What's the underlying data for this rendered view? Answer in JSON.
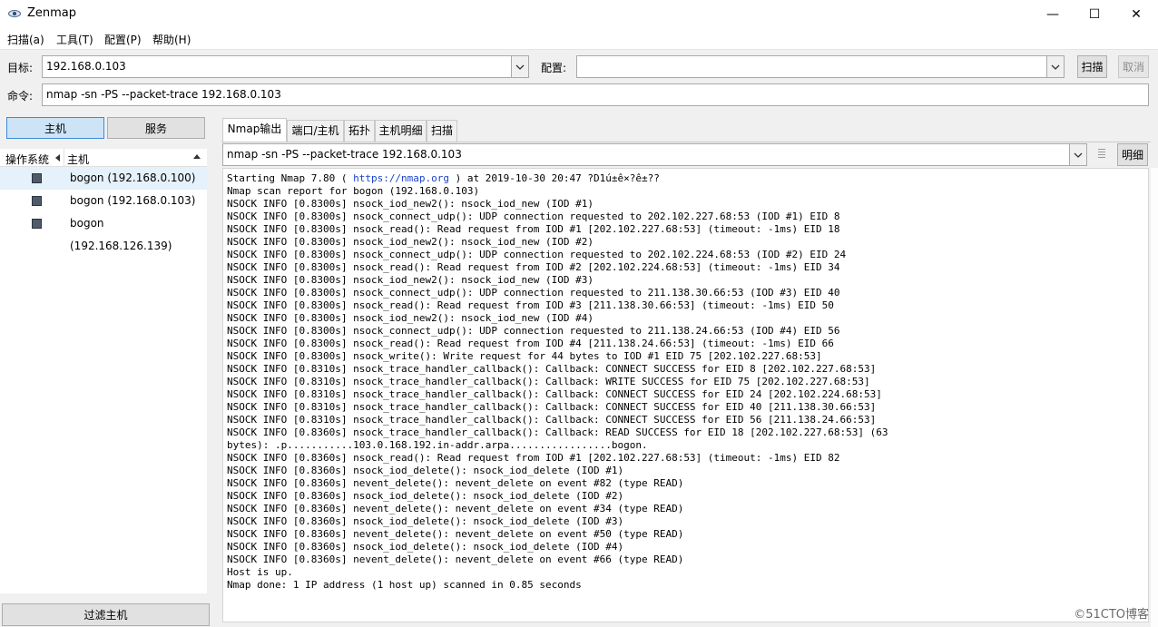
{
  "window": {
    "title": "Zenmap",
    "minimize": "—",
    "maximize": "☐",
    "close": "✕"
  },
  "menu": [
    "扫描(a)",
    "工具(T)",
    "配置(P)",
    "帮助(H)"
  ],
  "toolbar": {
    "target_label": "目标:",
    "target_value": "192.168.0.103",
    "profile_label": "配置:",
    "profile_value": "",
    "scan_button": "扫描",
    "cancel_button": "取消",
    "command_label": "命令:",
    "command_value": "nmap -sn -PS --packet-trace 192.168.0.103"
  },
  "left": {
    "hosts_tab": "主机",
    "services_tab": "服务",
    "col_os": "操作系统",
    "col_host": "主机",
    "hosts": [
      {
        "label": "bogon (192.168.0.100)"
      },
      {
        "label": "bogon (192.168.0.103)"
      },
      {
        "label": "bogon (192.168.126.139)"
      }
    ],
    "filter_button": "过滤主机"
  },
  "right": {
    "tabs": [
      "Nmap输出",
      "端口/主机",
      "拓扑",
      "主机明细",
      "扫描"
    ],
    "command_select": "nmap -sn -PS --packet-trace 192.168.0.103",
    "details_button": "明细"
  },
  "output_lines": [
    "Starting Nmap 7.80 ( https://nmap.org ) at 2019-10-30 20:47 ?D1ú±ê×?ê±??",
    "Nmap scan report for bogon (192.168.0.103)",
    "NSOCK INFO [0.8300s] nsock_iod_new2(): nsock_iod_new (IOD #1)",
    "NSOCK INFO [0.8300s] nsock_connect_udp(): UDP connection requested to 202.102.227.68:53 (IOD #1) EID 8",
    "NSOCK INFO [0.8300s] nsock_read(): Read request from IOD #1 [202.102.227.68:53] (timeout: -1ms) EID 18",
    "NSOCK INFO [0.8300s] nsock_iod_new2(): nsock_iod_new (IOD #2)",
    "NSOCK INFO [0.8300s] nsock_connect_udp(): UDP connection requested to 202.102.224.68:53 (IOD #2) EID 24",
    "NSOCK INFO [0.8300s] nsock_read(): Read request from IOD #2 [202.102.224.68:53] (timeout: -1ms) EID 34",
    "NSOCK INFO [0.8300s] nsock_iod_new2(): nsock_iod_new (IOD #3)",
    "NSOCK INFO [0.8300s] nsock_connect_udp(): UDP connection requested to 211.138.30.66:53 (IOD #3) EID 40",
    "NSOCK INFO [0.8300s] nsock_read(): Read request from IOD #3 [211.138.30.66:53] (timeout: -1ms) EID 50",
    "NSOCK INFO [0.8300s] nsock_iod_new2(): nsock_iod_new (IOD #4)",
    "NSOCK INFO [0.8300s] nsock_connect_udp(): UDP connection requested to 211.138.24.66:53 (IOD #4) EID 56",
    "NSOCK INFO [0.8300s] nsock_read(): Read request from IOD #4 [211.138.24.66:53] (timeout: -1ms) EID 66",
    "NSOCK INFO [0.8300s] nsock_write(): Write request for 44 bytes to IOD #1 EID 75 [202.102.227.68:53]",
    "NSOCK INFO [0.8310s] nsock_trace_handler_callback(): Callback: CONNECT SUCCESS for EID 8 [202.102.227.68:53]",
    "NSOCK INFO [0.8310s] nsock_trace_handler_callback(): Callback: WRITE SUCCESS for EID 75 [202.102.227.68:53]",
    "NSOCK INFO [0.8310s] nsock_trace_handler_callback(): Callback: CONNECT SUCCESS for EID 24 [202.102.224.68:53]",
    "NSOCK INFO [0.8310s] nsock_trace_handler_callback(): Callback: CONNECT SUCCESS for EID 40 [211.138.30.66:53]",
    "NSOCK INFO [0.8310s] nsock_trace_handler_callback(): Callback: CONNECT SUCCESS for EID 56 [211.138.24.66:53]",
    "NSOCK INFO [0.8360s] nsock_trace_handler_callback(): Callback: READ SUCCESS for EID 18 [202.102.227.68:53] (63",
    "bytes): .p...........103.0.168.192.in-addr.arpa.................bogon.",
    "NSOCK INFO [0.8360s] nsock_read(): Read request from IOD #1 [202.102.227.68:53] (timeout: -1ms) EID 82",
    "NSOCK INFO [0.8360s] nsock_iod_delete(): nsock_iod_delete (IOD #1)",
    "NSOCK INFO [0.8360s] nevent_delete(): nevent_delete on event #82 (type READ)",
    "NSOCK INFO [0.8360s] nsock_iod_delete(): nsock_iod_delete (IOD #2)",
    "NSOCK INFO [0.8360s] nevent_delete(): nevent_delete on event #34 (type READ)",
    "NSOCK INFO [0.8360s] nsock_iod_delete(): nsock_iod_delete (IOD #3)",
    "NSOCK INFO [0.8360s] nevent_delete(): nevent_delete on event #50 (type READ)",
    "NSOCK INFO [0.8360s] nsock_iod_delete(): nsock_iod_delete (IOD #4)",
    "NSOCK INFO [0.8360s] nevent_delete(): nevent_delete on event #66 (type READ)",
    "Host is up.",
    "Nmap done: 1 IP address (1 host up) scanned in 0.85 seconds"
  ],
  "watermark": "©51CTO博客",
  "colors": {
    "link": "#1a43c8",
    "active_tab_bg": "#ffffff",
    "pane_bg": "#f0f0f0"
  }
}
